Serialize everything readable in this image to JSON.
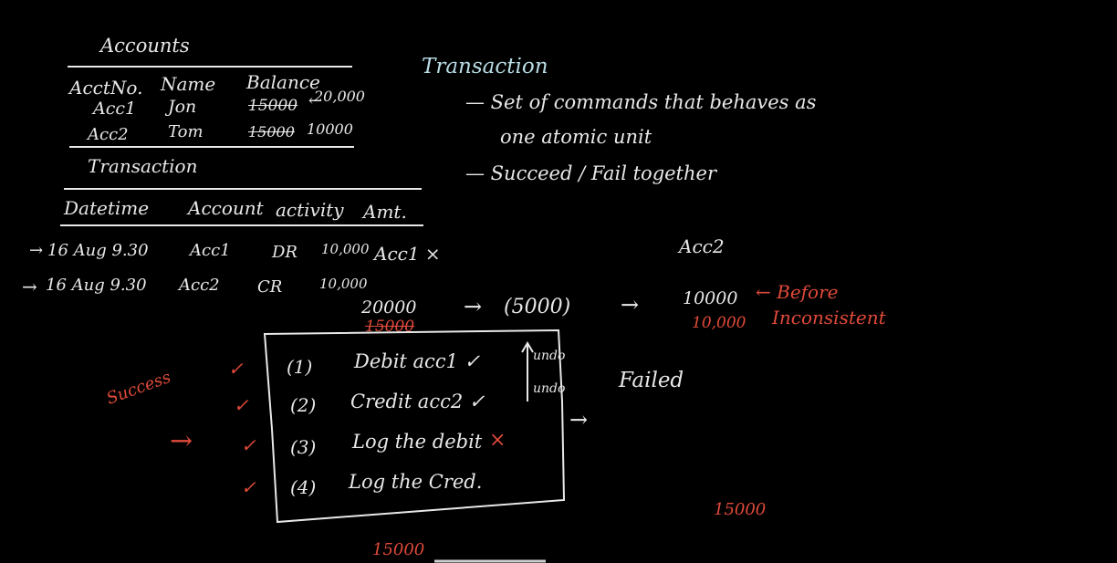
{
  "accounts": {
    "title": "Accounts",
    "headers": [
      "AcctNo.",
      "Name",
      "Balance"
    ],
    "rows": [
      {
        "acct": "Acc1",
        "name": "Jon",
        "old_balance": "15000",
        "note": "20,000"
      },
      {
        "acct": "Acc2",
        "name": "Tom",
        "old_balance": "15000",
        "new_balance": "10000"
      }
    ]
  },
  "transaction_table": {
    "title": "Transaction",
    "headers": [
      "Datetime",
      "Account",
      "activity",
      "Amt."
    ],
    "rows": [
      {
        "arrow": "→",
        "datetime": "16 Aug 9.30",
        "account": "Acc1",
        "activity": "DR",
        "amount": "10,000",
        "extra": "Acc1 ×"
      },
      {
        "arrow": "→",
        "datetime": "16 Aug 9.30",
        "account": "Acc2",
        "activity": "CR",
        "amount": "10,000"
      }
    ]
  },
  "definition": {
    "title": "Transaction",
    "bullet1_line1": "— Set of commands that behaves as",
    "bullet1_line2": "one atomic unit",
    "bullet2": "— Succeed / Fail together"
  },
  "flow": {
    "acc2_label": "Acc2",
    "left_value": "20000",
    "left_struck": "15000",
    "arrow1": "→",
    "middle": "(5000)",
    "arrow2": "→",
    "right_value": "10000",
    "before_label": "← Before",
    "inconsistent_value": "10,000",
    "inconsistent_label": "Inconsistent"
  },
  "steps": [
    {
      "num": "(1)",
      "text": "Debit acc1 ✓"
    },
    {
      "num": "(2)",
      "text": "Credit acc2 ✓"
    },
    {
      "num": "(3)",
      "text": "Log the debit",
      "mark": "×"
    },
    {
      "num": "(4)",
      "text": "Log the Cred."
    }
  ],
  "undo_labels": [
    "undo",
    "undo"
  ],
  "success_label": "Success",
  "pointer_arrow": "→",
  "failed": {
    "arrow": "→",
    "label": "Failed"
  },
  "checks": [
    "✓",
    "✓",
    "✓",
    "✓"
  ],
  "bottom_values": {
    "right": "15000",
    "bottom": "15000"
  }
}
